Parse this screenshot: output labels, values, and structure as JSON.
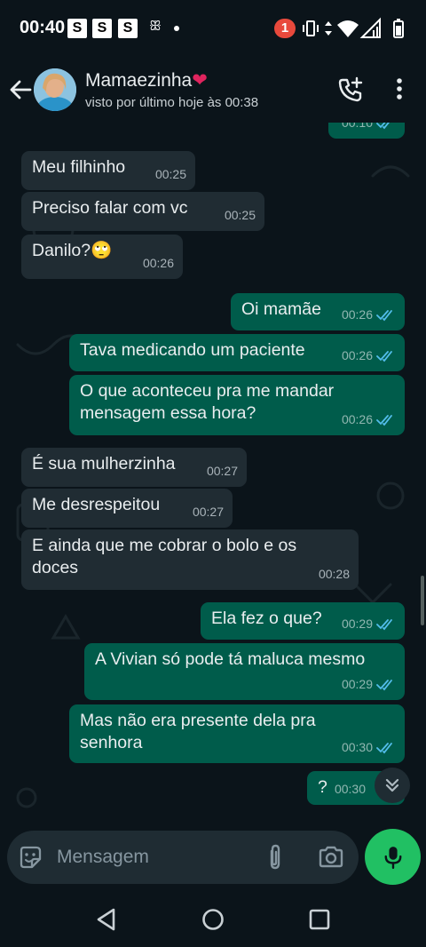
{
  "status_bar": {
    "time": "00:40",
    "s_icons": [
      "S",
      "S",
      "S"
    ],
    "notification_count": "1"
  },
  "header": {
    "contact_name": "Mamaezinha",
    "name_emoji": "❤",
    "last_seen": "visto por último hoje às 00:38"
  },
  "messages": [
    {
      "dir": "out",
      "text": "",
      "time": "00:10"
    },
    {
      "dir": "in",
      "text": "Meu filhinho",
      "time": "00:25"
    },
    {
      "dir": "in",
      "text": "Preciso falar com vc",
      "time": "00:25"
    },
    {
      "dir": "in",
      "text": "Danilo?",
      "emoji": "🙄",
      "time": "00:26"
    },
    {
      "dir": "out",
      "text": "Oi mamãe",
      "time": "00:26"
    },
    {
      "dir": "out",
      "text": "Tava medicando um paciente",
      "time": "00:26"
    },
    {
      "dir": "out",
      "text": "O que aconteceu pra me mandar\nmensagem essa hora?",
      "time": "00:26"
    },
    {
      "dir": "in",
      "text": "É sua mulherzinha",
      "time": "00:27"
    },
    {
      "dir": "in",
      "text": "Me desrespeitou",
      "time": "00:27"
    },
    {
      "dir": "in",
      "text": "E ainda que me cobrar o bolo e os\ndoces",
      "time": "00:28"
    },
    {
      "dir": "out",
      "text": "Ela fez o que?",
      "time": "00:29"
    },
    {
      "dir": "out",
      "text": "A Vivian só pode tá maluca mesmo",
      "time": "00:29"
    },
    {
      "dir": "out",
      "text": "Mas não era presente dela pra\nsenhora",
      "time": "00:30"
    },
    {
      "dir": "out",
      "text": "?",
      "time": "00:30"
    }
  ],
  "composer": {
    "placeholder": "Mensagem"
  },
  "icons": {
    "back": "arrow-left-icon",
    "call": "add-call-icon",
    "menu": "more-vert-icon",
    "sticker": "sticker-icon",
    "attach": "paperclip-icon",
    "camera": "camera-icon",
    "mic": "mic-icon",
    "scroll": "double-chevron-down-icon",
    "read_receipt": "double-check-icon"
  },
  "colors": {
    "background": "#0b141a",
    "incoming_bubble": "#202c33",
    "outgoing_bubble": "#005c4b",
    "read_check": "#53bdeb",
    "mic_button": "#21c063",
    "notification_badge": "#e8493c"
  }
}
